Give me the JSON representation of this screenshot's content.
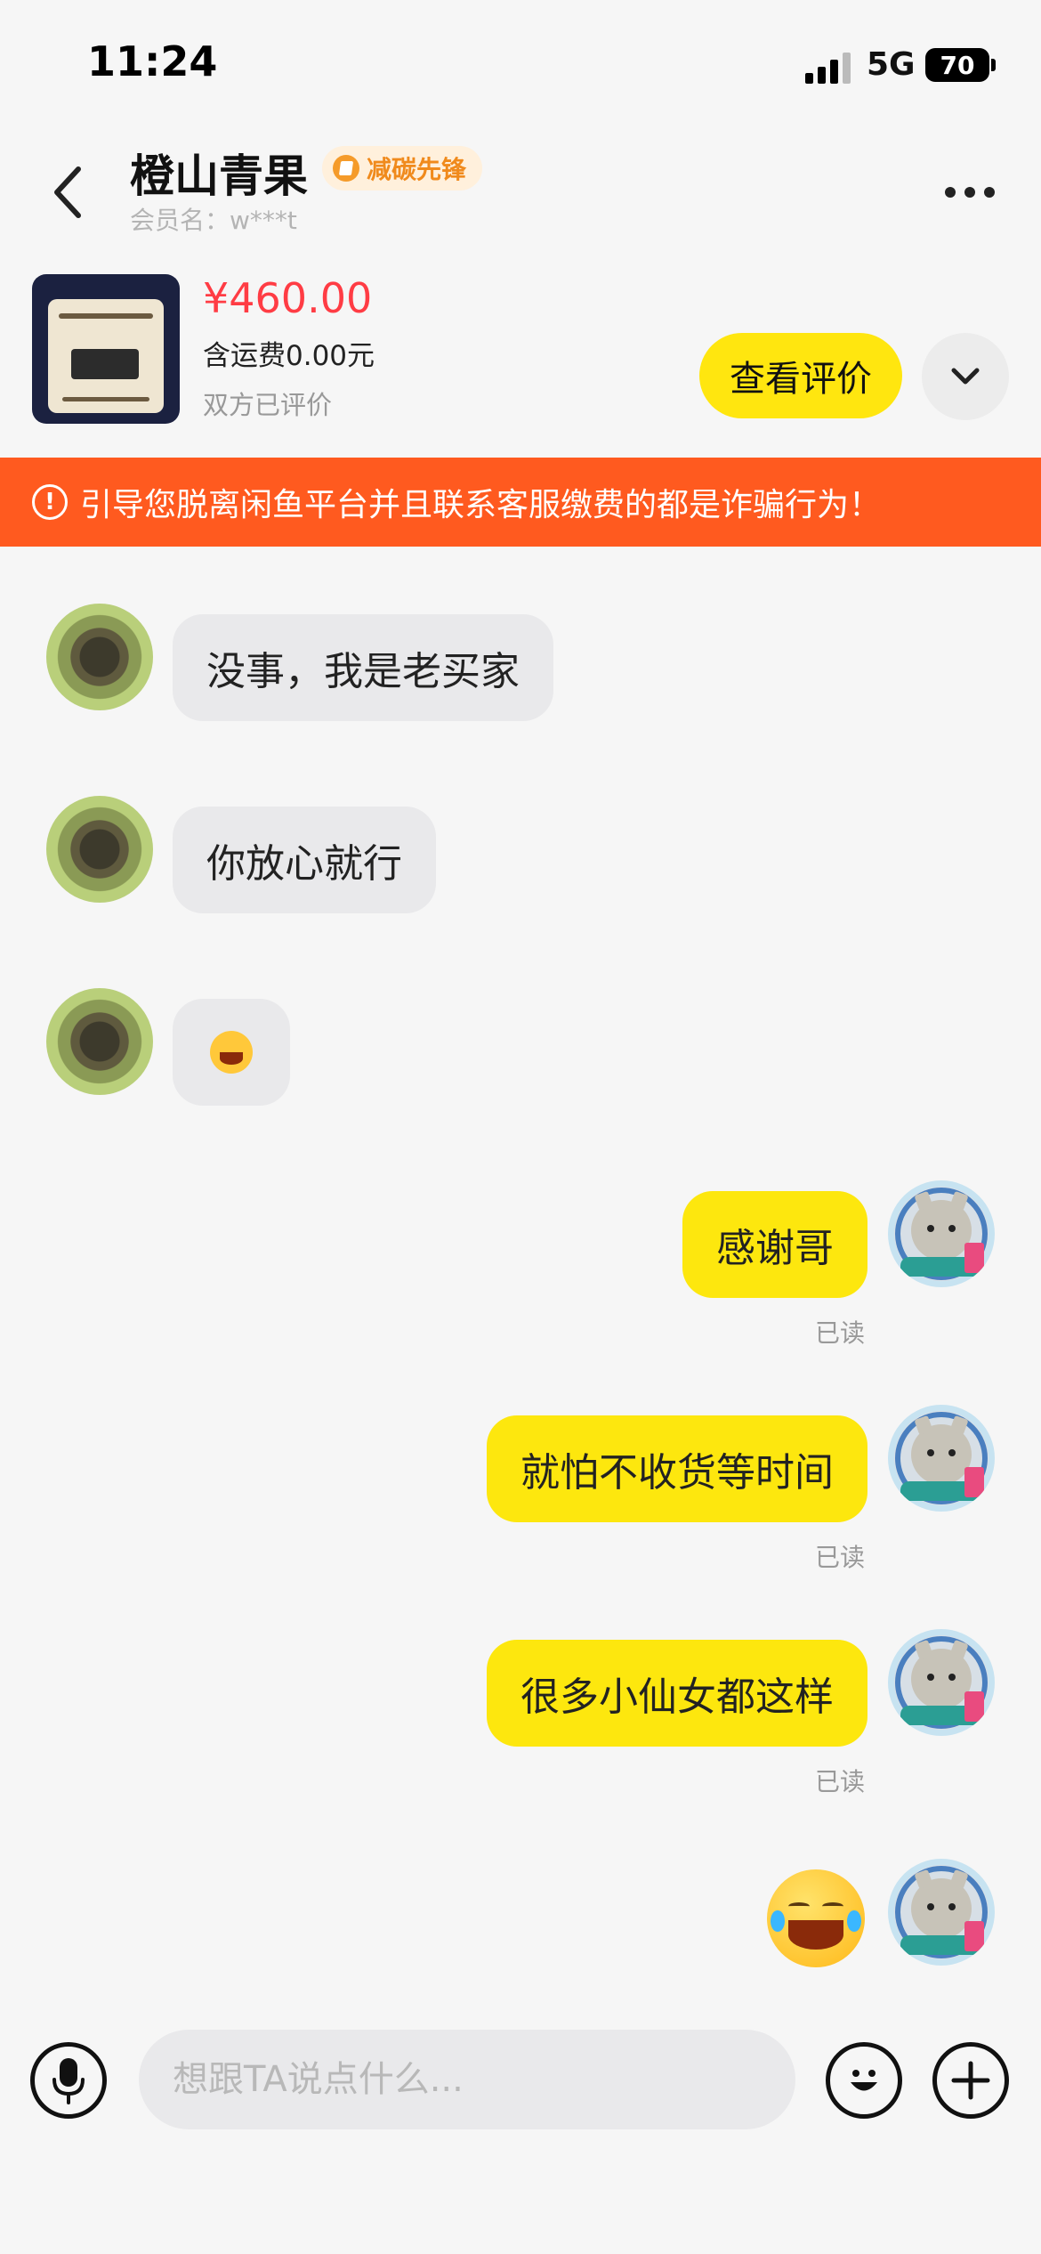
{
  "status_bar": {
    "time": "11:24",
    "network": "5G",
    "battery": "70"
  },
  "header": {
    "seller_name": "橙山青果",
    "badge": "减碳先锋",
    "member_name": "会员名：w***t"
  },
  "product": {
    "price": "¥460.00",
    "shipping": "含运费0.00元",
    "status": "双方已评价",
    "review_button": "查看评价"
  },
  "warning": {
    "text": "引导您脱离闲鱼平台并且联系客服缴费的都是诈骗行为！"
  },
  "messages": {
    "m1": "没事，我是老买家",
    "m2": "你放心就行",
    "m4": "感谢哥",
    "m5": "就怕不收货等时间",
    "m6": "很多小仙女都这样",
    "read": "已读"
  },
  "input": {
    "placeholder": "想跟TA说点什么..."
  },
  "icons": {
    "back": "back-arrow-icon",
    "more": "more-icon",
    "expand": "chevron-down-icon",
    "warning": "alert-circle-icon",
    "voice": "microphone-icon",
    "emoji": "emoji-icon",
    "add": "plus-icon"
  },
  "colors": {
    "accent_yellow": "#fde70e",
    "price_red": "#ff3c44",
    "warning_orange": "#ff5a1f",
    "badge_orange": "#f08a1c"
  }
}
